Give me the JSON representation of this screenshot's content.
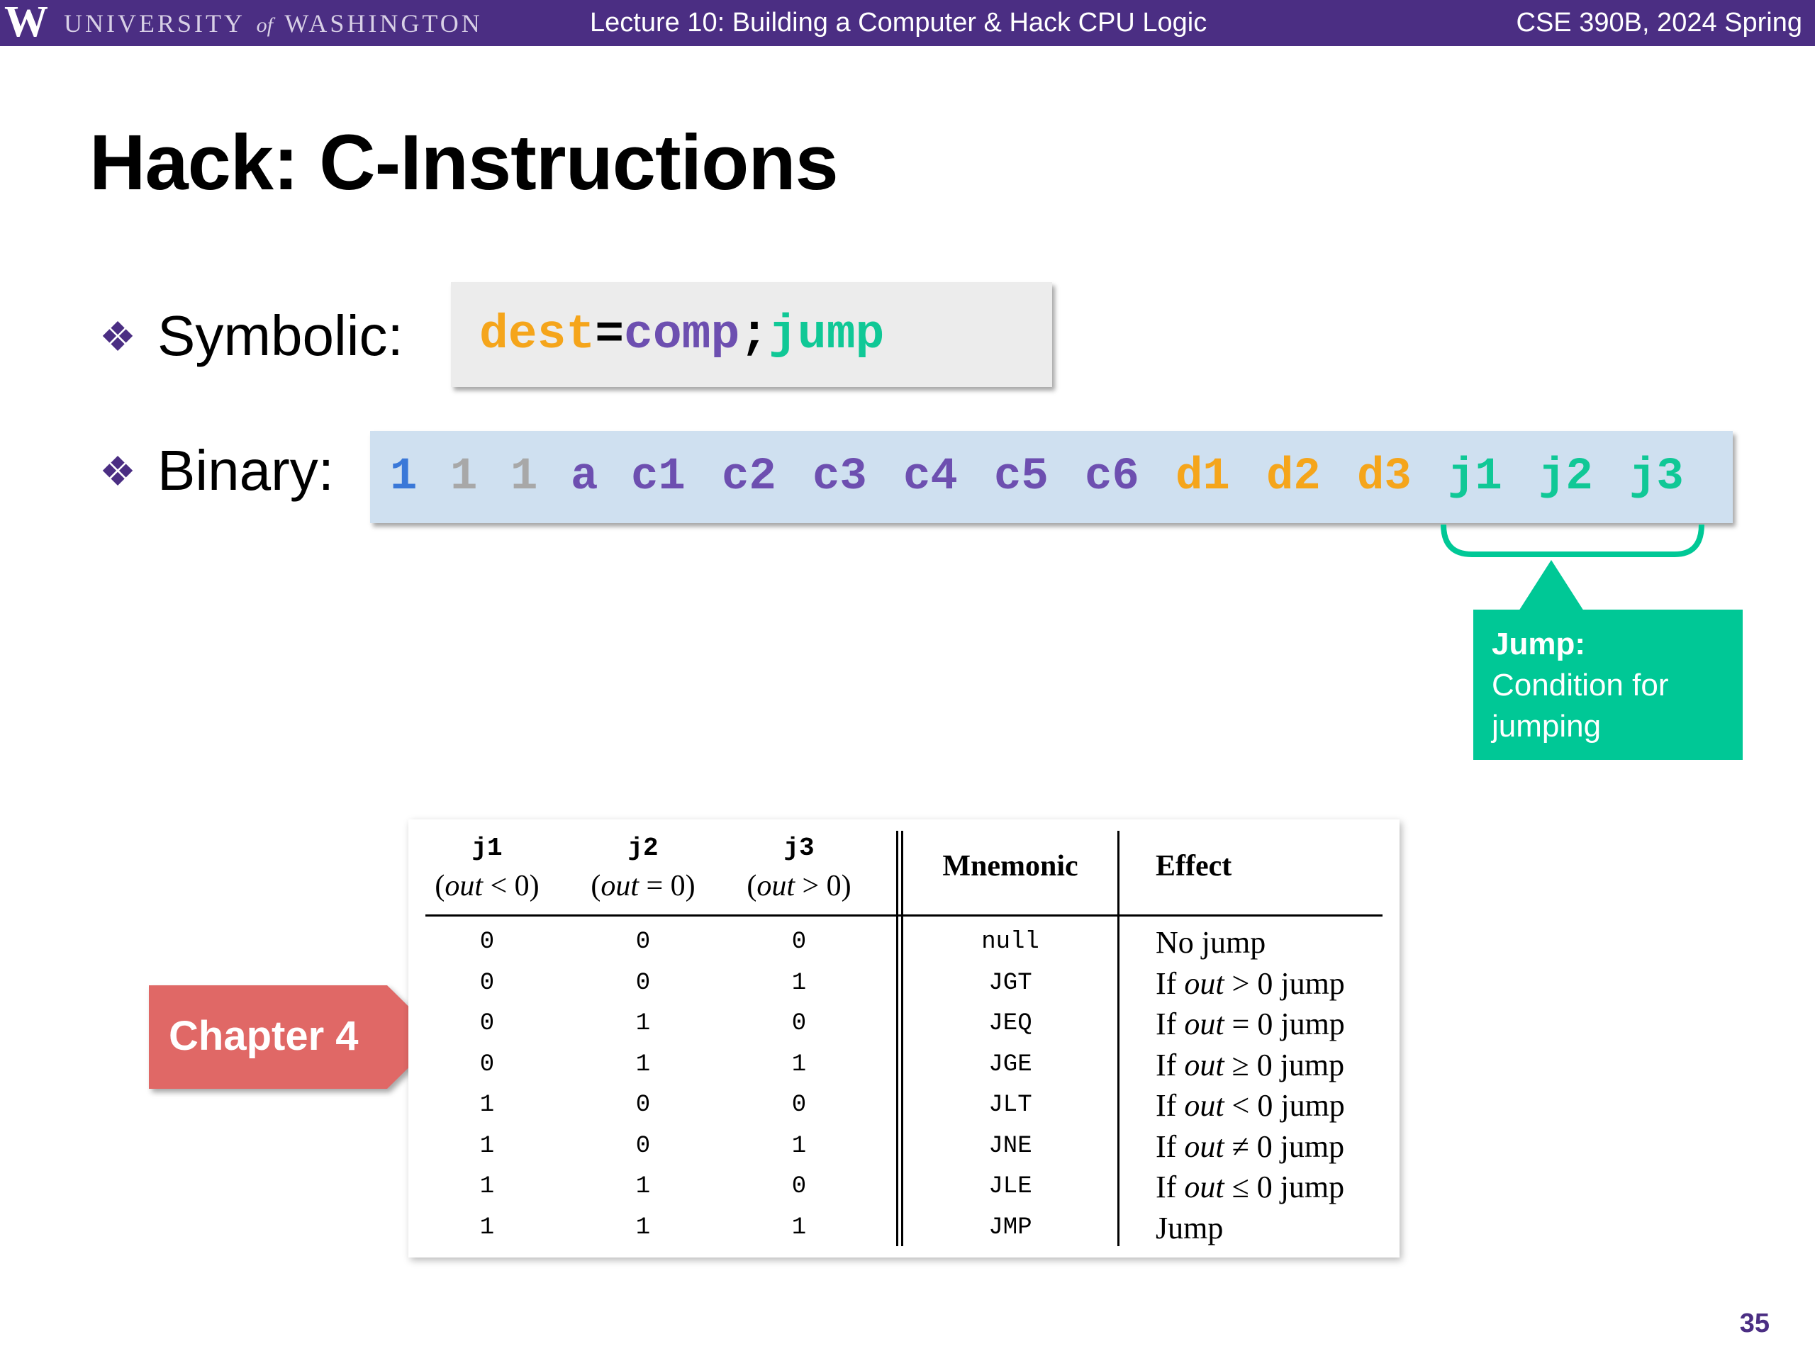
{
  "header": {
    "logo_letter": "W",
    "university_pre": "UNIVERSITY",
    "university_of": "of",
    "university_post": "WASHINGTON",
    "lecture_title": "Lecture 10: Building a Computer & Hack CPU Logic",
    "course": "CSE 390B, 2024 Spring"
  },
  "slide": {
    "title": "Hack: C-Instructions",
    "page_number": "35"
  },
  "symbolic": {
    "label": "Symbolic:",
    "dest": "dest",
    "eq": "=",
    "comp": "comp",
    "semi": ";",
    "jump": "jump"
  },
  "binary": {
    "label": "Binary:",
    "bits": [
      "1",
      "1",
      "1",
      "a",
      "c1",
      "c2",
      "c3",
      "c4",
      "c5",
      "c6",
      "d1",
      "d2",
      "d3",
      "j1",
      "j2",
      "j3"
    ]
  },
  "callout": {
    "heading": "Jump:",
    "line1": "Condition for",
    "line2": "jumping"
  },
  "chapter_badge": "Chapter 4",
  "jump_table": {
    "headers": {
      "j1": "j1",
      "j1_cond_var": "out",
      "j1_cond_op": "< 0",
      "j2": "j2",
      "j2_cond_var": "out",
      "j2_cond_op": "= 0",
      "j3": "j3",
      "j3_cond_var": "out",
      "j3_cond_op": "> 0",
      "mnemonic": "Mnemonic",
      "effect": "Effect"
    },
    "rows": [
      {
        "j1": "0",
        "j2": "0",
        "j3": "0",
        "mnemonic": "null",
        "effect_pre": "No jump",
        "effect_var": "",
        "effect_post": ""
      },
      {
        "j1": "0",
        "j2": "0",
        "j3": "1",
        "mnemonic": "JGT",
        "effect_pre": "If ",
        "effect_var": "out",
        "effect_post": " > 0 jump"
      },
      {
        "j1": "0",
        "j2": "1",
        "j3": "0",
        "mnemonic": "JEQ",
        "effect_pre": "If ",
        "effect_var": "out",
        "effect_post": " = 0 jump"
      },
      {
        "j1": "0",
        "j2": "1",
        "j3": "1",
        "mnemonic": "JGE",
        "effect_pre": "If ",
        "effect_var": "out",
        "effect_post": " ≥ 0 jump"
      },
      {
        "j1": "1",
        "j2": "0",
        "j3": "0",
        "mnemonic": "JLT",
        "effect_pre": "If ",
        "effect_var": "out",
        "effect_post": " < 0 jump"
      },
      {
        "j1": "1",
        "j2": "0",
        "j3": "1",
        "mnemonic": "JNE",
        "effect_pre": "If ",
        "effect_var": "out",
        "effect_post": " ≠ 0 jump"
      },
      {
        "j1": "1",
        "j2": "1",
        "j3": "0",
        "mnemonic": "JLE",
        "effect_pre": "If ",
        "effect_var": "out",
        "effect_post": " ≤ 0 jump"
      },
      {
        "j1": "1",
        "j2": "1",
        "j3": "1",
        "mnemonic": "JMP",
        "effect_pre": "Jump",
        "effect_var": "",
        "effect_post": ""
      }
    ]
  },
  "colors": {
    "uw_purple": "#4b2e83",
    "dest_orange": "#f5a51b",
    "comp_purple": "#6d4fb0",
    "jump_teal": "#10c896",
    "callout_green": "#00c896",
    "badge_red": "#e06866"
  }
}
